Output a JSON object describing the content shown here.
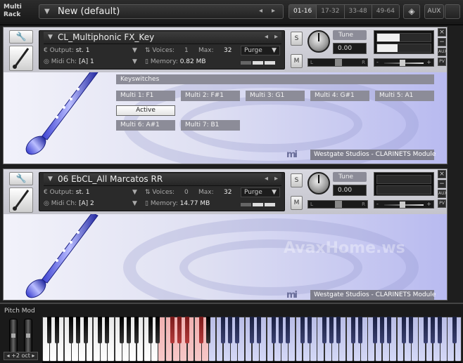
{
  "top_bar": {
    "rack_title": "Multi\nRack",
    "multi_name": "New (default)",
    "page_tabs": [
      "01-16",
      "17-32",
      "33-48",
      "49-64"
    ],
    "active_tab": "01-16",
    "aux_label": "AUX"
  },
  "instruments": [
    {
      "name": "CL_Multiphonic FX_Key",
      "output_label": "Output:",
      "output_value": "st. 1",
      "voices_label": "Voices:",
      "voices_value": "1",
      "max_label": "Max:",
      "max_value": "32",
      "purge_label": "Purge",
      "midi_label": "Midi Ch:",
      "midi_value": "[A]  1",
      "memory_label": "Memory:",
      "memory_value": "0.82 MB",
      "solo_label": "S",
      "mute_label": "M",
      "tune_label": "Tune",
      "tune_value": "0.00",
      "pan_left": "L",
      "pan_right": "R",
      "vol_minus": "-",
      "vol_plus": "+",
      "close_label": "×",
      "collapse_label": "−",
      "aux_label": "AUX",
      "pv_label": "PV",
      "keyswitch_title": "Keyswitches",
      "keyswitches": [
        "Multi 1: F1",
        "Multi 2: F#1",
        "Multi 3: G1",
        "Multi 4: G#1",
        "Multi 5: A1",
        "Multi 6: A#1",
        "Multi 7: B1"
      ],
      "active_label": "Active",
      "credit": "Westgate Studios - CLARINETS Module",
      "meter_levels": [
        0.42,
        0.38
      ]
    },
    {
      "name": "06 EbCL_All Marcatos RR",
      "output_label": "Output:",
      "output_value": "st. 1",
      "voices_label": "Voices:",
      "voices_value": "0",
      "max_label": "Max:",
      "max_value": "32",
      "purge_label": "Purge",
      "midi_label": "Midi Ch:",
      "midi_value": "[A]  2",
      "memory_label": "Memory:",
      "memory_value": "14.77 MB",
      "solo_label": "S",
      "mute_label": "M",
      "tune_label": "Tune",
      "tune_value": "0.00",
      "pan_left": "L",
      "pan_right": "R",
      "vol_minus": "-",
      "vol_plus": "+",
      "close_label": "×",
      "collapse_label": "−",
      "aux_label": "AUX",
      "pv_label": "PV",
      "watermark": "AvaxHome.ws",
      "credit": "Westgate Studios - CLARINETS Module",
      "meter_levels": [
        0,
        0
      ]
    }
  ],
  "keyboard": {
    "pitch_mod_label": "Pitch Mod",
    "octave_label": "+2 oct",
    "octave_left": "◂",
    "octave_right": "▸",
    "red_range": [
      16,
      22
    ],
    "blue_range": [
      23,
      57
    ],
    "red_color": "#f0b0b0",
    "blue_color": "#c4c8f0"
  }
}
